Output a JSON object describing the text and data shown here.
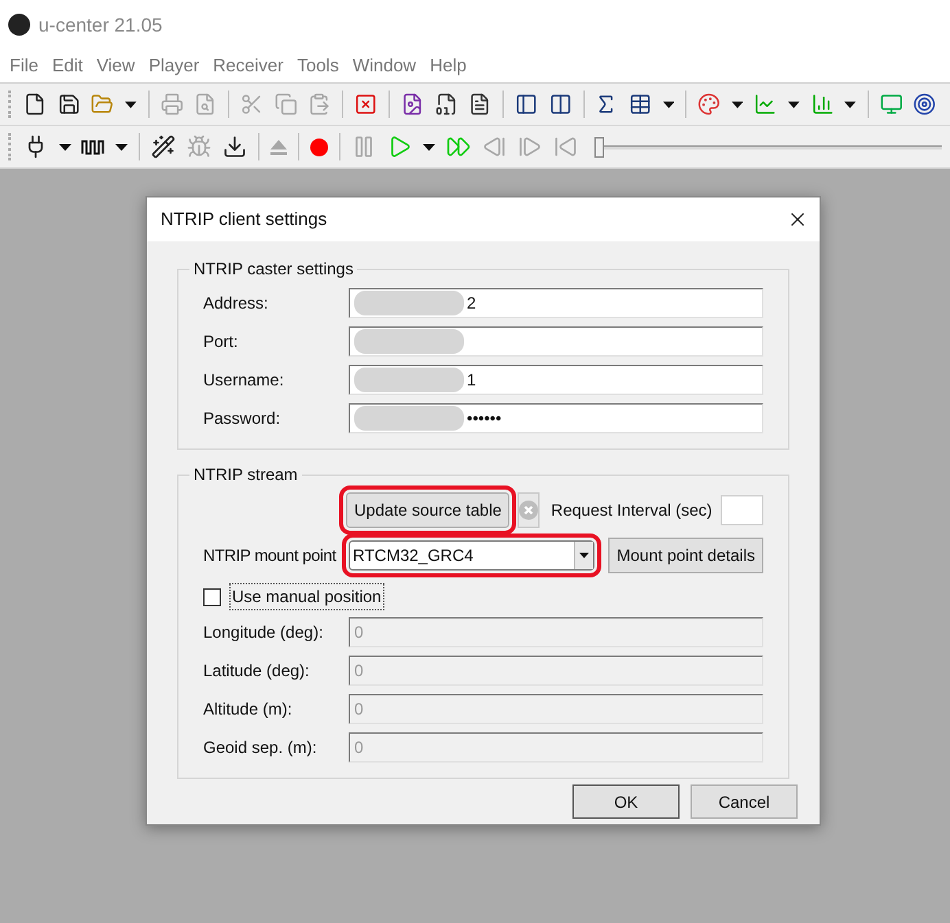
{
  "window": {
    "title": "u-center 21.05"
  },
  "menu": [
    "File",
    "Edit",
    "View",
    "Player",
    "Receiver",
    "Tools",
    "Window",
    "Help"
  ],
  "toolbar_rows": [
    [
      {
        "kind": "new",
        "disabled": false
      },
      {
        "kind": "save",
        "disabled": false
      },
      {
        "kind": "open",
        "disabled": false
      },
      {
        "kind": "dropdown",
        "disabled": false
      },
      {
        "kind": "separator"
      },
      {
        "kind": "print",
        "disabled": true
      },
      {
        "kind": "preview",
        "disabled": true
      },
      {
        "kind": "separator"
      },
      {
        "kind": "cut",
        "disabled": true
      },
      {
        "kind": "copy",
        "disabled": true
      },
      {
        "kind": "paste",
        "disabled": true
      },
      {
        "kind": "separator"
      },
      {
        "kind": "clear",
        "disabled": false
      },
      {
        "kind": "separator"
      },
      {
        "kind": "image-doc",
        "disabled": false
      },
      {
        "kind": "binary-doc",
        "disabled": false
      },
      {
        "kind": "text-doc",
        "disabled": false
      },
      {
        "kind": "separator"
      },
      {
        "kind": "panel-left",
        "disabled": false
      },
      {
        "kind": "panel-split",
        "disabled": false
      },
      {
        "kind": "separator"
      },
      {
        "kind": "sigma",
        "disabled": false
      },
      {
        "kind": "table",
        "disabled": false
      },
      {
        "kind": "dropdown",
        "disabled": false
      },
      {
        "kind": "separator"
      },
      {
        "kind": "palette",
        "disabled": false
      },
      {
        "kind": "dropdown",
        "disabled": false
      },
      {
        "kind": "line-chart",
        "disabled": false
      },
      {
        "kind": "dropdown",
        "disabled": false
      },
      {
        "kind": "bar-chart",
        "disabled": false
      },
      {
        "kind": "dropdown",
        "disabled": false
      },
      {
        "kind": "separator"
      },
      {
        "kind": "monitor",
        "disabled": false
      },
      {
        "kind": "target",
        "disabled": false
      }
    ],
    [
      {
        "kind": "plug",
        "disabled": false
      },
      {
        "kind": "dropdown",
        "disabled": false
      },
      {
        "kind": "wave",
        "disabled": false
      },
      {
        "kind": "dropdown",
        "disabled": false
      },
      {
        "kind": "separator"
      },
      {
        "kind": "wand",
        "disabled": false
      },
      {
        "kind": "bug",
        "disabled": true
      },
      {
        "kind": "download",
        "disabled": false
      },
      {
        "kind": "separator"
      },
      {
        "kind": "eject",
        "disabled": true
      },
      {
        "kind": "separator"
      },
      {
        "kind": "record",
        "disabled": false
      },
      {
        "kind": "separator"
      },
      {
        "kind": "pause",
        "disabled": true
      },
      {
        "kind": "play",
        "disabled": false
      },
      {
        "kind": "dropdown",
        "disabled": false
      },
      {
        "kind": "fast-forward",
        "disabled": false
      },
      {
        "kind": "step-back",
        "disabled": true
      },
      {
        "kind": "step-forward",
        "disabled": true
      },
      {
        "kind": "skip-back",
        "disabled": true
      },
      {
        "kind": "slider",
        "level": 0
      }
    ]
  ],
  "dialog": {
    "title": "NTRIP client settings",
    "caster_group": {
      "title": "NTRIP caster settings",
      "fields": [
        {
          "label": "Address:",
          "value": "2",
          "redacted": true
        },
        {
          "label": "Port:",
          "redacted": true
        },
        {
          "label": "Username:",
          "value": "1",
          "redacted": true
        },
        {
          "label": "Password:",
          "value": "••••••",
          "redacted": true
        }
      ]
    },
    "stream_group": {
      "title": "NTRIP stream",
      "update_button": {
        "label": "Update source table",
        "highlighted": true
      },
      "request_interval": {
        "label": "Request Interval (sec)"
      },
      "mount_point": {
        "label": "NTRIP mount point",
        "value": "RTCM32_GRC4",
        "highlighted": true
      },
      "details_button": {
        "label": "Mount point details"
      },
      "manual_position": {
        "label": "Use manual position",
        "checked": false
      },
      "position_fields": [
        {
          "label": "Longitude (deg):",
          "value": "0",
          "disabled": true
        },
        {
          "label": "Latitude (deg):",
          "value": "0",
          "disabled": true
        },
        {
          "label": "Altitude (m):",
          "value": "0",
          "disabled": true
        },
        {
          "label": "Geoid sep. (m):",
          "value": "0",
          "disabled": true
        }
      ]
    },
    "buttons": [
      "OK",
      "Cancel"
    ]
  }
}
